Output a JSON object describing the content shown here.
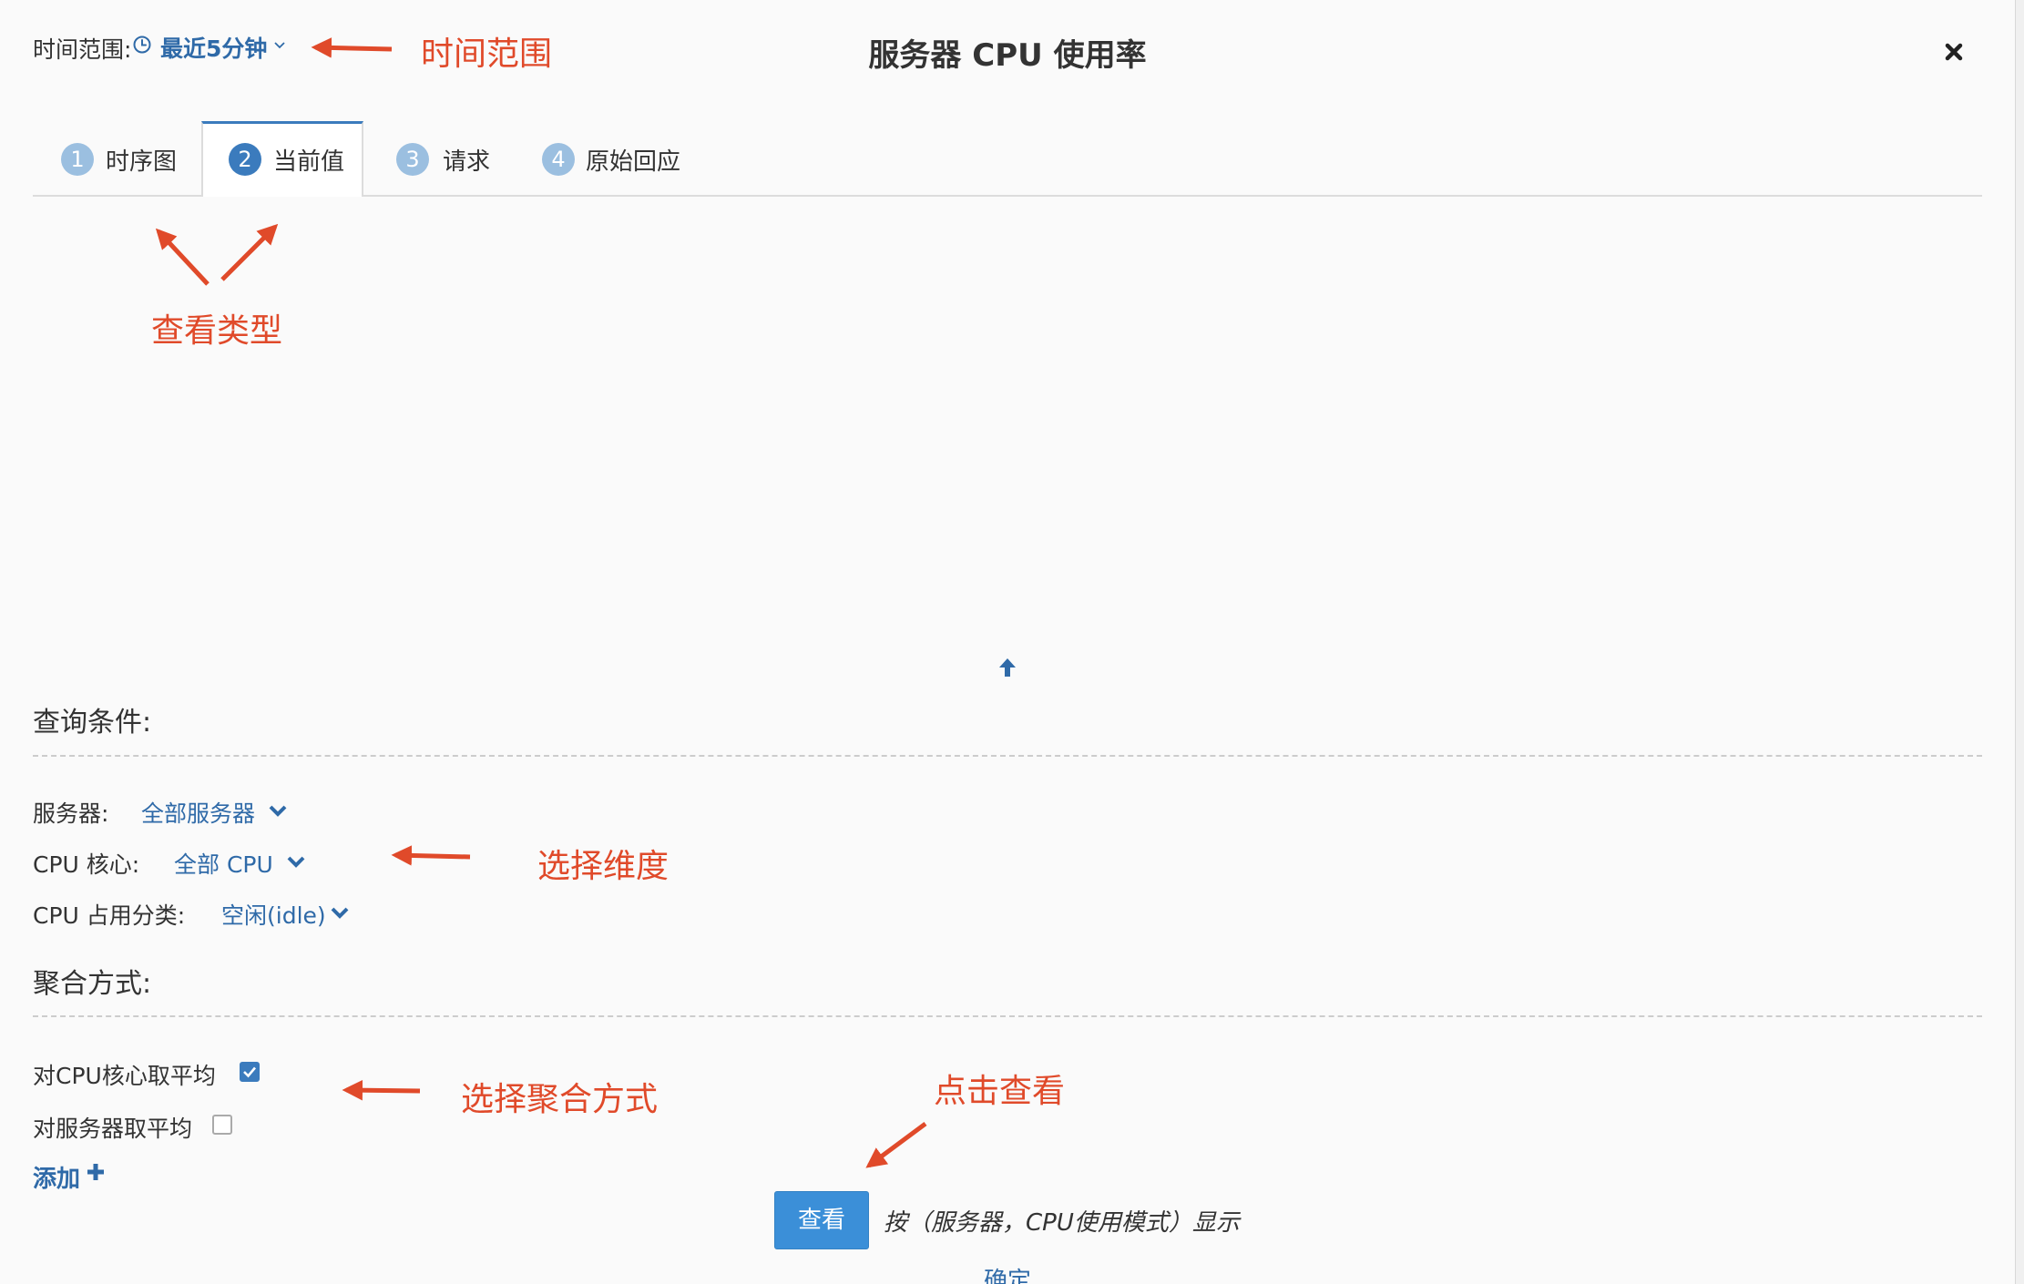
{
  "header": {
    "time_range_label": "时间范围:",
    "time_range_value": "最近5分钟",
    "title": "服务器 CPU 使用率"
  },
  "tabs": [
    {
      "num": "1",
      "label": "时序图",
      "active": false
    },
    {
      "num": "2",
      "label": "当前值",
      "active": true
    },
    {
      "num": "3",
      "label": "请求",
      "active": false
    },
    {
      "num": "4",
      "label": "原始回应",
      "active": false
    }
  ],
  "annotations": {
    "time_range": "时间范围",
    "view_type": "查看类型",
    "select_dimension": "选择维度",
    "select_aggregation": "选择聚合方式",
    "click_view": "点击查看"
  },
  "query": {
    "title": "查询条件:",
    "filters": [
      {
        "label": "服务器:",
        "value": "全部服务器"
      },
      {
        "label": "CPU 核心:",
        "value": "全部 CPU"
      },
      {
        "label": "CPU 占用分类:",
        "value": "空闲(idle)"
      }
    ]
  },
  "aggregation": {
    "title": "聚合方式:",
    "options": [
      {
        "label": "对CPU核心取平均",
        "checked": true
      },
      {
        "label": "对服务器取平均",
        "checked": false
      }
    ],
    "add_label": "添加"
  },
  "actions": {
    "view_label": "查看",
    "view_hint": "按（服务器，CPU使用模式）显示",
    "confirm_label": "确定"
  },
  "colors": {
    "accent": "#3b7bbd",
    "link": "#2f6aa8",
    "annotation": "#e04a2a",
    "button": "#3b8fd8"
  }
}
